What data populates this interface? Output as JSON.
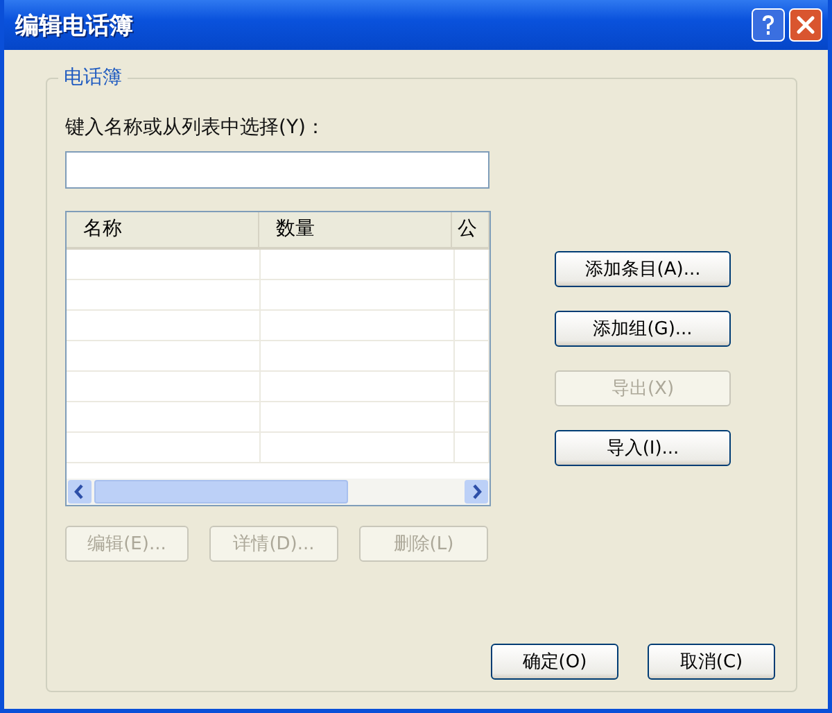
{
  "window": {
    "title": "编辑电话簿"
  },
  "group": {
    "label": "电话簿"
  },
  "name_field": {
    "label": "键入名称或从列表中选择(Y)："
  },
  "list": {
    "columns": [
      "名称",
      "数量",
      "公"
    ]
  },
  "list_buttons": [
    {
      "label": "编辑(E)...",
      "disabled": true
    },
    {
      "label": "详情(D)...",
      "disabled": true
    },
    {
      "label": "删除(L)",
      "disabled": true
    }
  ],
  "side_buttons": [
    {
      "label": "添加条目(A)...",
      "disabled": false
    },
    {
      "label": "添加组(G)...",
      "disabled": false
    },
    {
      "label": "导出(X)",
      "disabled": true
    },
    {
      "label": "导入(I)...",
      "disabled": false
    }
  ],
  "dialog_buttons": [
    {
      "label": "确定(O)",
      "disabled": false
    },
    {
      "label": "取消(C)",
      "disabled": false
    }
  ]
}
